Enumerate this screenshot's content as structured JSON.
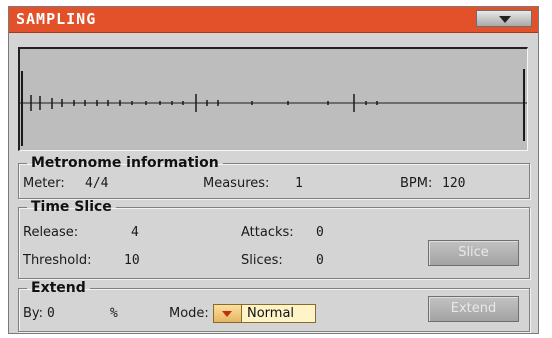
{
  "window": {
    "title": "SAMPLING",
    "menu_icon": "chevron-down-icon"
  },
  "metronome": {
    "legend": "Metronome information",
    "meter_label": "Meter:",
    "meter_value": "4/4",
    "measures_label": "Measures:",
    "measures_value": "1",
    "bpm_label": "BPM:",
    "bpm_value": "120"
  },
  "time_slice": {
    "legend": "Time Slice",
    "release_label": "Release:",
    "release_value": "4",
    "attacks_label": "Attacks:",
    "attacks_value": "0",
    "threshold_label": "Threshold:",
    "threshold_value": "10",
    "slices_label": "Slices:",
    "slices_value": "0",
    "slice_button": "Slice"
  },
  "extend": {
    "legend": "Extend",
    "by_label": "By:",
    "by_value": "0",
    "by_unit": "%",
    "mode_label": "Mode:",
    "mode_value": "Normal",
    "extend_button": "Extend"
  },
  "colors": {
    "titlebar": "#e2512a",
    "panel": "#d4d4d4",
    "waveform_bg": "#bdbdbd",
    "mode_select_bg": "#fff3c8",
    "mode_arrow": "#c03010"
  }
}
